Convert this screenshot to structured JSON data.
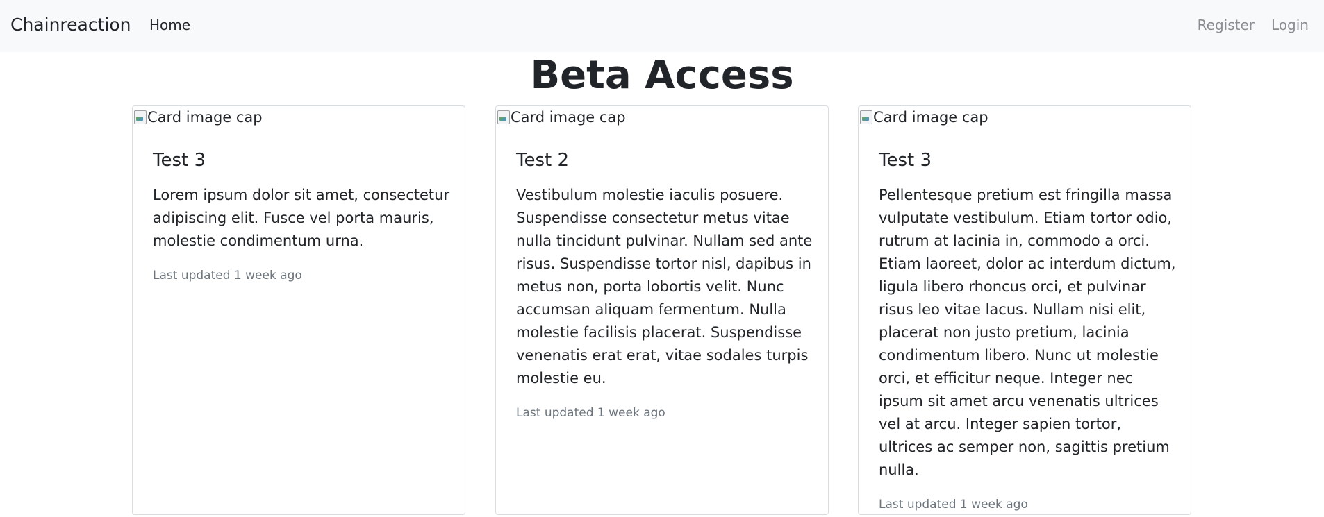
{
  "navbar": {
    "brand": "Chainreaction",
    "home": "Home",
    "register": "Register",
    "login": "Login"
  },
  "page": {
    "title": "Beta Access"
  },
  "cards": [
    {
      "image_alt": "Card image cap",
      "title": "Test 3",
      "text": "Lorem ipsum dolor sit amet, consectetur adipiscing elit. Fusce vel porta mauris, molestie condimentum urna.",
      "updated": "Last updated 1 week ago"
    },
    {
      "image_alt": "Card image cap",
      "title": "Test 2",
      "text": "Vestibulum molestie iaculis posuere. Suspendisse consectetur metus vitae nulla tincidunt pulvinar. Nullam sed ante risus. Suspendisse tortor nisl, dapibus in metus non, porta lobortis velit. Nunc accumsan aliquam fermentum. Nulla molestie facilisis placerat. Suspendisse venenatis erat erat, vitae sodales turpis molestie eu.",
      "updated": "Last updated 1 week ago"
    },
    {
      "image_alt": "Card image cap",
      "title": "Test 3",
      "text": "Pellentesque pretium est fringilla massa vulputate vestibulum. Etiam tortor odio, rutrum at lacinia in, commodo a orci. Etiam laoreet, dolor ac interdum dictum, ligula libero rhoncus orci, et pulvinar risus leo vitae lacus. Nullam nisi elit, placerat non justo pretium, lacinia condimentum libero. Nunc ut molestie orci, et efficitur neque. Integer nec ipsum sit amet arcu venenatis ultrices vel at arcu. Integer sapien tortor, ultrices ac semper non, sagittis pretium nulla.",
      "updated": "Last updated 1 week ago"
    }
  ]
}
